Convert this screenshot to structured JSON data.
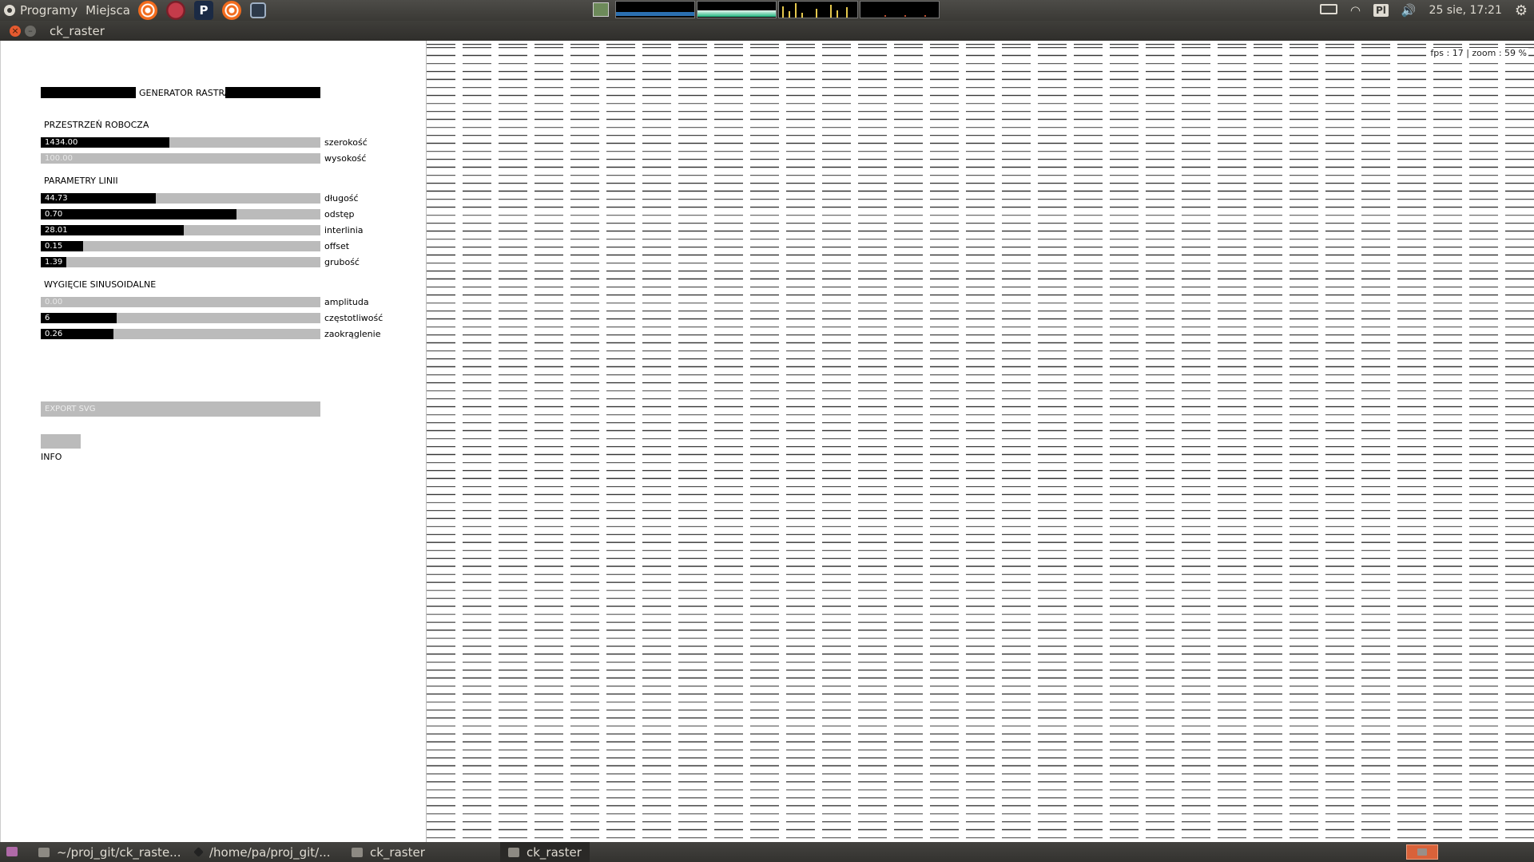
{
  "top_panel": {
    "menus": [
      "Programy",
      "Miejsca"
    ],
    "launchers": [
      "houdini-icon",
      "red-sphere-icon",
      "p-app-icon",
      "houdini-icon",
      "film-icon"
    ],
    "p_glyph": "P",
    "keyboard_layout": "Pl",
    "clock": "25 sie, 17:21"
  },
  "window": {
    "title": "ck_raster"
  },
  "app": {
    "header": "GENERATOR RASTRA",
    "sections": {
      "workspace": "PRZESTRZEŃ ROBOCZA",
      "line_params": "PARAMETRY LINII",
      "sine": "WYGIĘCIE SINUSOIDALNE"
    },
    "sliders": [
      {
        "label": "szerokość",
        "value": "1434.00",
        "fill": 0.46
      },
      {
        "label": "wysokość",
        "value": "100.00",
        "fill": 0.0
      },
      {
        "label": "długość",
        "value": "44.73",
        "fill": 0.41
      },
      {
        "label": "odstęp",
        "value": "0.70",
        "fill": 0.7
      },
      {
        "label": "interlinia",
        "value": "28.01",
        "fill": 0.51
      },
      {
        "label": "offset",
        "value": "0.15",
        "fill": 0.15
      },
      {
        "label": "grubość",
        "value": "1.39",
        "fill": 0.09
      },
      {
        "label": "amplituda",
        "value": "0.00",
        "fill": 0.0
      },
      {
        "label": "częstotliwość",
        "value": "6",
        "fill": 0.27
      },
      {
        "label": "zaokrąglenie",
        "value": "0.26",
        "fill": 0.26
      }
    ],
    "export_label": "EXPORT SVG",
    "info_label": "INFO",
    "canvas_status": "fps : 17 | zoom : 59 %"
  },
  "taskbar": {
    "items": [
      "~/proj_git/ck_raste...",
      "/home/pa/proj_git/...",
      "ck_raster",
      "ck_raster"
    ]
  },
  "colors": {
    "panel_bg": "#3c3b37",
    "slider_track": "#bbbbbb",
    "slider_fill": "#000000",
    "close_button": "#e55a2f",
    "workspace_indicator": "#d9623a"
  }
}
